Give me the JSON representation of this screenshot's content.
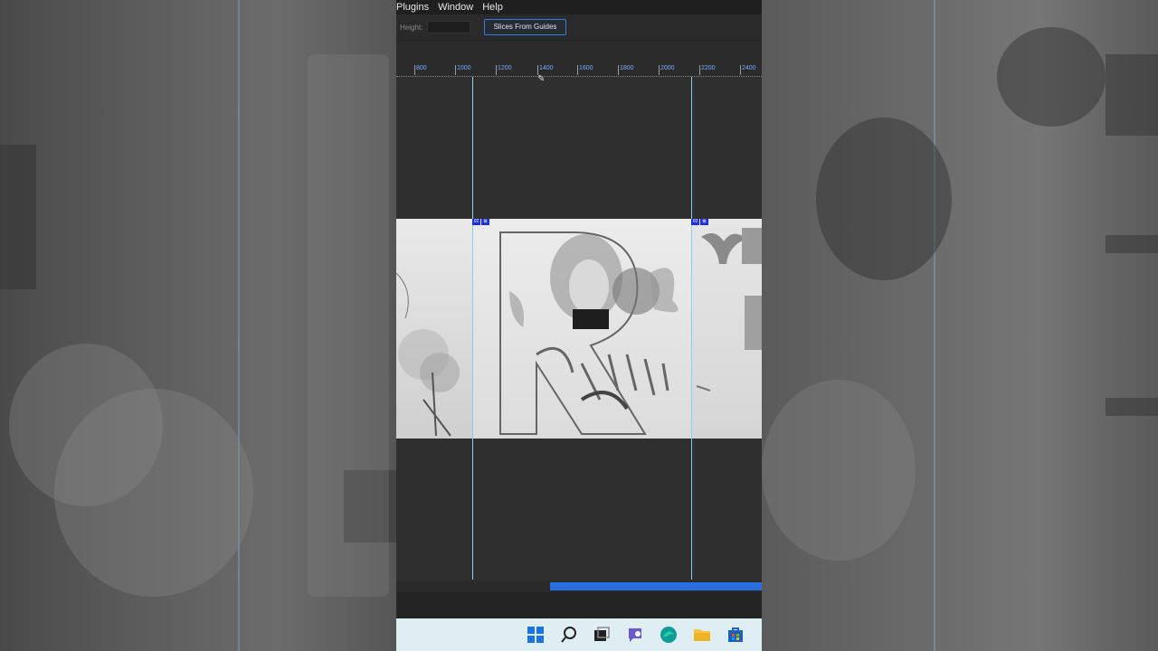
{
  "menu": {
    "items": [
      "Plugins",
      "Window",
      "Help"
    ]
  },
  "options_bar": {
    "height_label": "Height:",
    "height_value": "",
    "slices_button_label": "Slices From Guides"
  },
  "ruler": {
    "ticks": [
      "800",
      "1000",
      "1200",
      "1400",
      "1600",
      "1800",
      "2000",
      "2200",
      "2400"
    ],
    "accent_color": "#7aa8ff"
  },
  "slices": {
    "tag_a": [
      "02",
      "⊠"
    ],
    "tag_b": [
      "03",
      "⊠"
    ],
    "guide_color": "#8fd0e0"
  },
  "scrollbar": {
    "accent_color": "#2a6fe0"
  },
  "taskbar": {
    "icons": [
      "windows-start-icon",
      "search-icon",
      "task-view-icon",
      "chat-icon",
      "edge-browser-icon",
      "file-explorer-icon",
      "store-icon"
    ]
  }
}
